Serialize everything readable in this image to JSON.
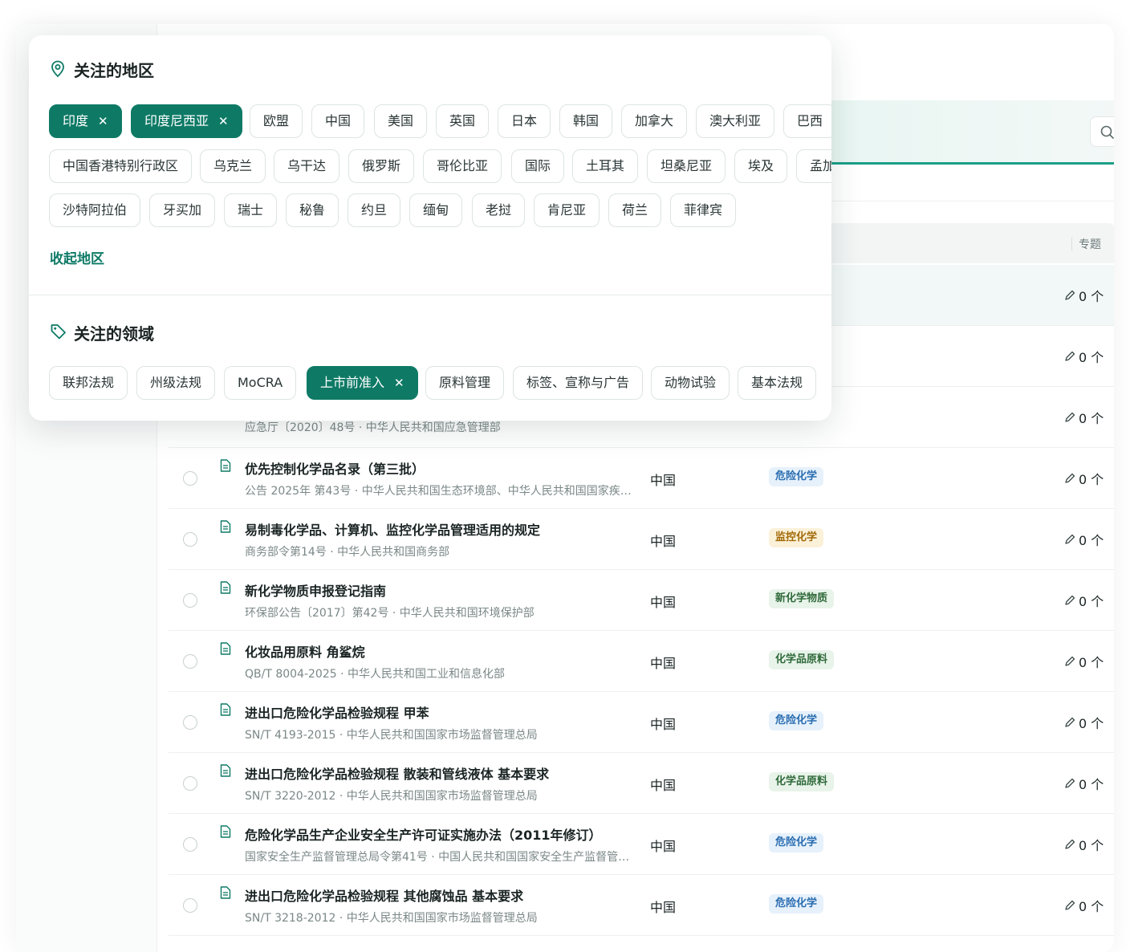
{
  "regions_section": {
    "title": "关注的地区",
    "collapse_label": "收起地区",
    "chips": [
      {
        "label": "印度",
        "selected": true
      },
      {
        "label": "印度尼西亚",
        "selected": true
      },
      {
        "label": "欧盟",
        "selected": false
      },
      {
        "label": "中国",
        "selected": false
      },
      {
        "label": "美国",
        "selected": false
      },
      {
        "label": "英国",
        "selected": false
      },
      {
        "label": "日本",
        "selected": false
      },
      {
        "label": "韩国",
        "selected": false
      },
      {
        "label": "加拿大",
        "selected": false
      },
      {
        "label": "澳大利亚",
        "selected": false
      },
      {
        "label": "巴西",
        "selected": false
      },
      {
        "label": "中国香港特别行政区",
        "selected": false
      },
      {
        "label": "乌克兰",
        "selected": false
      },
      {
        "label": "乌干达",
        "selected": false
      },
      {
        "label": "俄罗斯",
        "selected": false
      },
      {
        "label": "哥伦比亚",
        "selected": false
      },
      {
        "label": "国际",
        "selected": false
      },
      {
        "label": "土耳其",
        "selected": false
      },
      {
        "label": "坦桑尼亚",
        "selected": false
      },
      {
        "label": "埃及",
        "selected": false
      },
      {
        "label": "孟加",
        "selected": false
      },
      {
        "label": "沙特阿拉伯",
        "selected": false
      },
      {
        "label": "牙买加",
        "selected": false
      },
      {
        "label": "瑞士",
        "selected": false
      },
      {
        "label": "秘鲁",
        "selected": false
      },
      {
        "label": "约旦",
        "selected": false
      },
      {
        "label": "缅甸",
        "selected": false
      },
      {
        "label": "老挝",
        "selected": false
      },
      {
        "label": "肯尼亚",
        "selected": false
      },
      {
        "label": "荷兰",
        "selected": false
      },
      {
        "label": "菲律宾",
        "selected": false
      }
    ]
  },
  "domains_section": {
    "title": "关注的领域",
    "chips": [
      {
        "label": "联邦法规",
        "selected": false
      },
      {
        "label": "州级法规",
        "selected": false
      },
      {
        "label": "MoCRA",
        "selected": false
      },
      {
        "label": "上市前准入",
        "selected": true
      },
      {
        "label": "原料管理",
        "selected": false
      },
      {
        "label": "标签、宣称与广告",
        "selected": false
      },
      {
        "label": "动物试验",
        "selected": false
      },
      {
        "label": "基本法规",
        "selected": false
      }
    ]
  },
  "table": {
    "topic_header": "专题",
    "partial_meta": "应急厅〔2020〕48号 · 中华人民共和国应急管理部",
    "blank_rows": [
      {
        "count": "0 个"
      },
      {
        "count": "0 个"
      },
      {
        "count": "0 个"
      }
    ],
    "rows": [
      {
        "title": "优先控制化学品名录（第三批）",
        "meta": "公告 2025年 第43号 · 中华人民共和国生态环境部、中华人民共和国国家疾病…",
        "region": "中国",
        "tag": "危险化学",
        "tag_color": "blue",
        "count": "0 个"
      },
      {
        "title": "易制毒化学品、计算机、监控化学品管理适用的规定",
        "meta": "商务部令第14号 · 中华人民共和国商务部",
        "region": "中国",
        "tag": "监控化学",
        "tag_color": "yellow",
        "count": "0 个"
      },
      {
        "title": "新化学物质申报登记指南",
        "meta": "环保部公告〔2017〕第42号 · 中华人民共和国环境保护部",
        "region": "中国",
        "tag": "新化学物质",
        "tag_color": "green",
        "count": "0 个"
      },
      {
        "title": "化妆品用原料 角鲨烷",
        "meta": "QB/T 8004-2025 · 中华人民共和国工业和信息化部",
        "region": "中国",
        "tag": "化学品原料",
        "tag_color": "green",
        "count": "0 个"
      },
      {
        "title": "进出口危险化学品检验规程 甲苯",
        "meta": "SN/T 4193-2015 · 中华人民共和国国家市场监督管理总局",
        "region": "中国",
        "tag": "危险化学",
        "tag_color": "blue",
        "count": "0 个"
      },
      {
        "title": "进出口危险化学品检验规程 散装和管线液体 基本要求",
        "meta": "SN/T 3220-2012 · 中华人民共和国国家市场监督管理总局",
        "region": "中国",
        "tag": "化学品原料",
        "tag_color": "green",
        "count": "0 个"
      },
      {
        "title": "危险化学品生产企业安全生产许可证实施办法（2011年修订）",
        "meta": "国家安全生产监督管理总局令第41号 · 中国人民共和国国家安全生产监督管…",
        "region": "中国",
        "tag": "危险化学",
        "tag_color": "blue",
        "count": "0 个"
      },
      {
        "title": "进出口危险化学品检验规程 其他腐蚀品 基本要求",
        "meta": "SN/T 3218-2012 · 中华人民共和国国家市场监督管理总局",
        "region": "中国",
        "tag": "危险化学",
        "tag_color": "blue",
        "count": "0 个"
      }
    ]
  },
  "colors": {
    "accent": "#0e7a66",
    "accent_line": "#1a9f88"
  }
}
